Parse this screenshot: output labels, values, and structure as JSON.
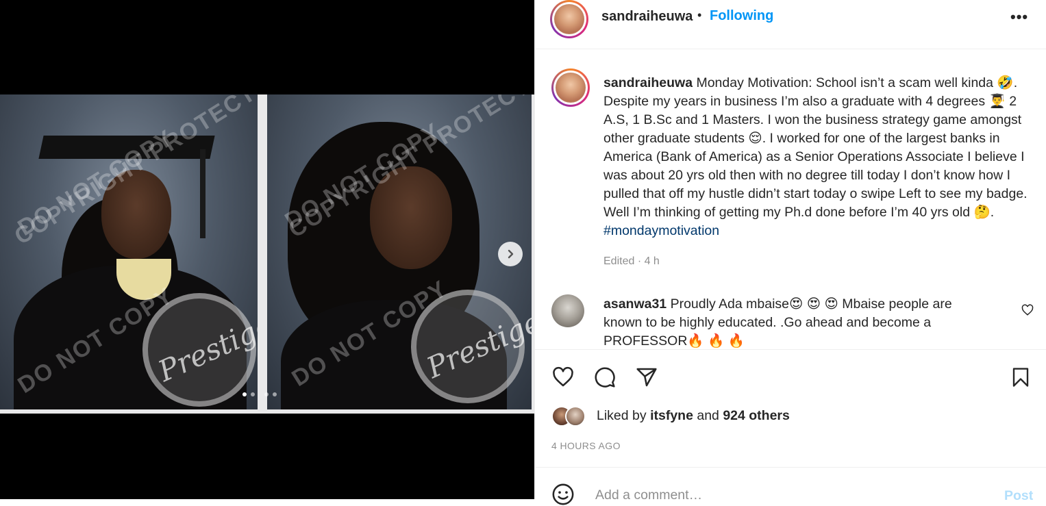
{
  "media": {
    "watermark_line1": "COPYRIGHT PROTECTED",
    "watermark_line2": "DO NOT COPY",
    "seal_text": "Prestige",
    "slide_count": 4,
    "active_slide": 1
  },
  "header": {
    "username": "sandraiheuwa",
    "separator": "•",
    "follow_label": "Following",
    "more_label": "•••"
  },
  "caption": {
    "username": "sandraiheuwa",
    "text_1": "Monday Motivation: School isn’t a scam well kinda 🤣. Despite my years in business I’m also a graduate with 4 degrees 👨‍🎓 2 A.S, 1 B.Sc and 1 Masters. I won the business strategy game amongst other graduate students 😌. I worked for one of the largest banks in America (Bank of America) as a Senior Operations Associate I believe I was about 20 yrs old then with no degree till today I don’t know how I pulled that off my hustle didn’t start today o swipe Left to see my badge. Well I’m thinking of getting my Ph.d done before I’m 40 yrs old 🤔.",
    "hashtag": "#mondaymotivation",
    "edited": "Edited · 4 h"
  },
  "comments": [
    {
      "username": "asanwa31",
      "text": "Proudly Ada mbaise😍 😍 😍  Mbaise people are known to be highly educated. .Go ahead and become a PROFESSOR🔥 🔥 🔥"
    }
  ],
  "likes": {
    "prefix": "Liked by",
    "user": "itsfyne",
    "joiner": "and",
    "others": "924 others"
  },
  "timestamp": "4 HOURS AGO",
  "add_comment": {
    "placeholder": "Add a comment…",
    "post_label": "Post"
  },
  "colors": {
    "accent": "#0095f6",
    "post_disabled": "#b2dffc",
    "hashtag": "#00376b",
    "muted": "#8e8e8e"
  },
  "icons": [
    "chevron-right-icon",
    "more-icon",
    "heart-icon",
    "comment-icon",
    "share-icon",
    "bookmark-icon",
    "emoji-icon"
  ]
}
